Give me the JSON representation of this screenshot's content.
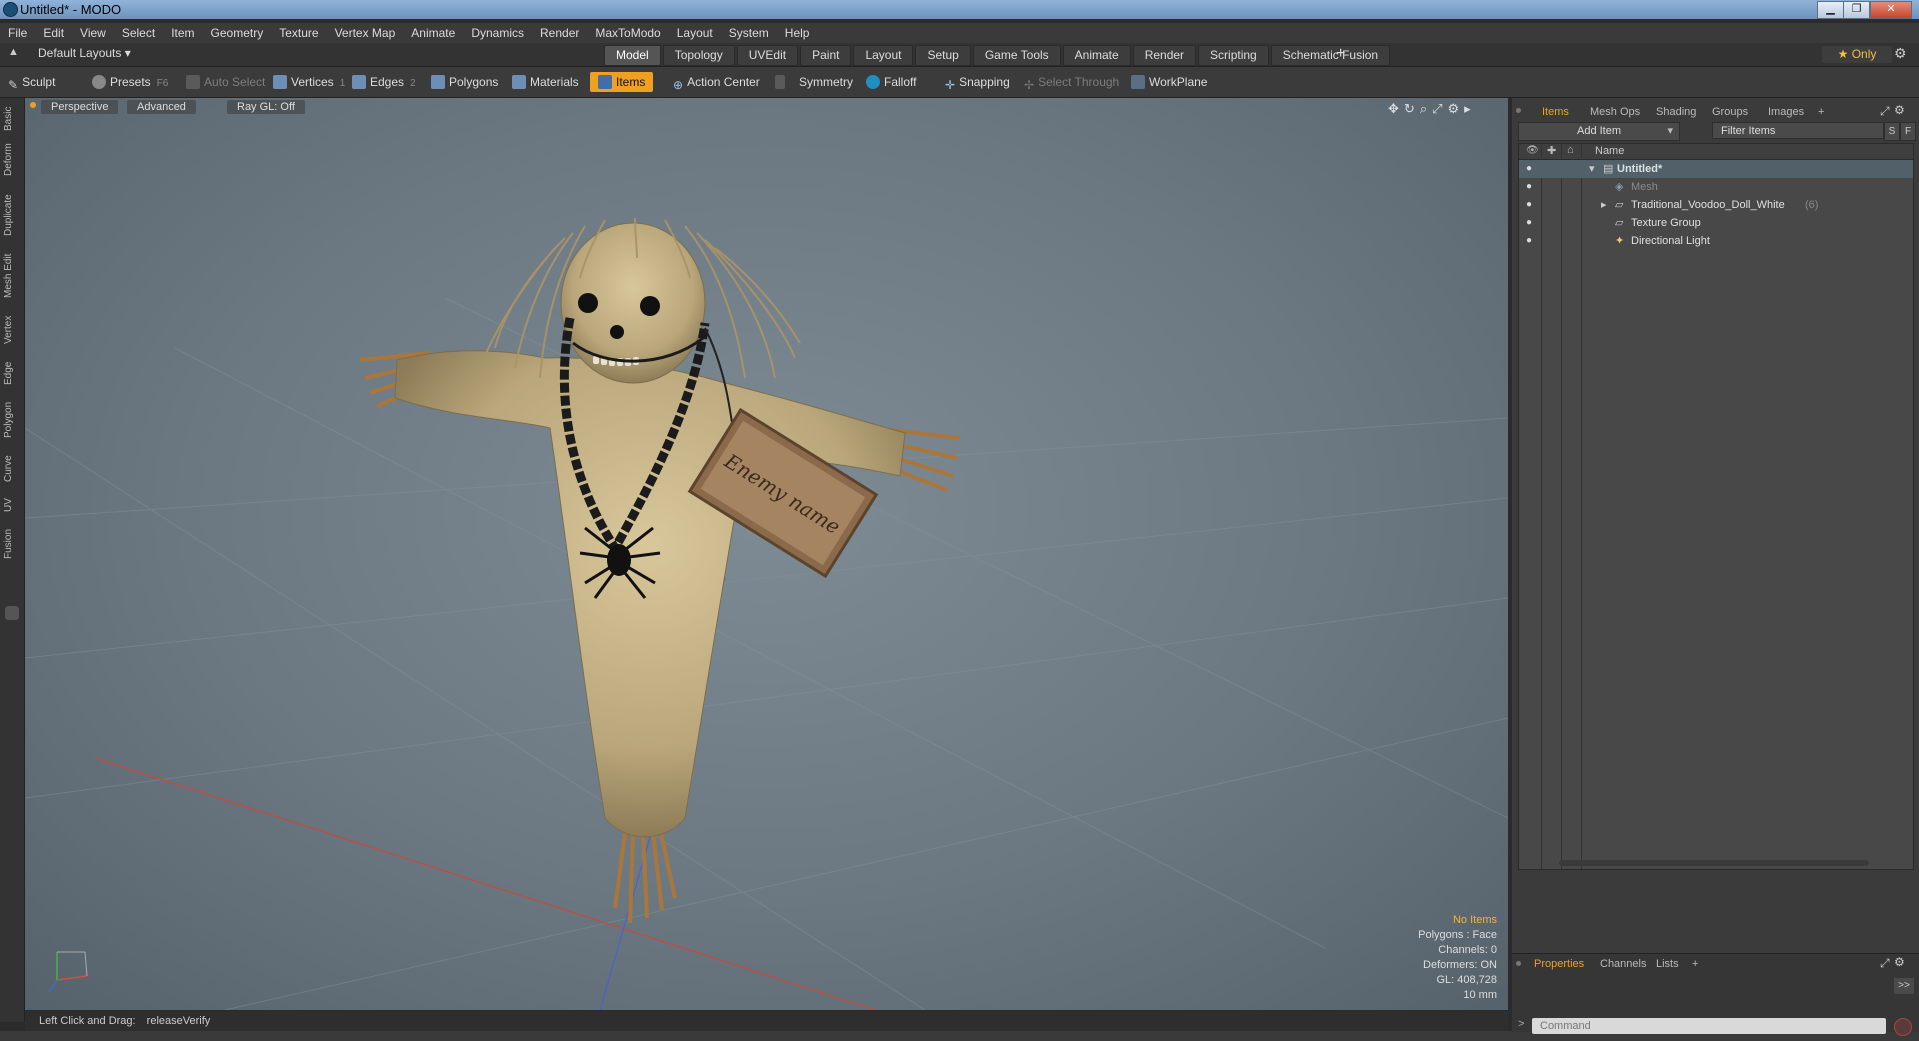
{
  "window": {
    "title": "Untitled* - MODO",
    "minimize": "▁",
    "maximize": "❐",
    "close": "✕"
  },
  "menu": [
    "File",
    "Edit",
    "View",
    "Select",
    "Item",
    "Geometry",
    "Texture",
    "Vertex Map",
    "Animate",
    "Dynamics",
    "Render",
    "MaxToModo",
    "Layout",
    "System",
    "Help"
  ],
  "layout_selector": "Default Layouts ▾",
  "layout_tabs": [
    {
      "label": "Model",
      "active": true
    },
    {
      "label": "Topology"
    },
    {
      "label": "UVEdit"
    },
    {
      "label": "Paint"
    },
    {
      "label": "Layout"
    },
    {
      "label": "Setup"
    },
    {
      "label": "Game Tools"
    },
    {
      "label": "Animate"
    },
    {
      "label": "Render"
    },
    {
      "label": "Scripting"
    },
    {
      "label": "Schematic Fusion"
    }
  ],
  "tabs_plus": "+",
  "only_label": "★ Only",
  "toolbar": {
    "sculpt": "Sculpt",
    "presets": "Presets",
    "presets_key": "F6",
    "auto_select": "Auto Select",
    "vertices": "Vertices",
    "vertices_key": "1",
    "edges": "Edges",
    "edges_key": "2",
    "polygons": "Polygons",
    "materials": "Materials",
    "items": "Items",
    "action_center": "Action Center",
    "symmetry": "Symmetry",
    "falloff": "Falloff",
    "snapping": "Snapping",
    "select_through": "Select Through",
    "workplane": "WorkPlane"
  },
  "left_tabs": [
    "Basic",
    "Deform",
    "Duplicate",
    "Mesh Edit",
    "Vertex",
    "Edge",
    "Polygon",
    "Curve",
    "UV",
    "Fusion"
  ],
  "viewport": {
    "perspective": "Perspective",
    "advanced": "Advanced",
    "raygl": "Ray GL: Off",
    "tag_text": "Enemy name",
    "hud": {
      "no_items": "No Items",
      "polygons": "Polygons : Face",
      "channels": "Channels: 0",
      "deformers": "Deformers: ON",
      "gl": "GL: 408,728",
      "unit": "10 mm"
    }
  },
  "status": {
    "hint": "Left Click and Drag:",
    "action": "releaseVerify"
  },
  "panel": {
    "tabs": [
      {
        "label": "Items",
        "active": true
      },
      {
        "label": "Mesh Ops"
      },
      {
        "label": "Shading"
      },
      {
        "label": "Groups"
      },
      {
        "label": "Images"
      },
      {
        "label": "+"
      }
    ],
    "add_item": "Add Item",
    "filter_placeholder": "Filter Items",
    "s_btn": "S",
    "f_btn": "F",
    "tree_header": "Name",
    "tree": [
      {
        "label": "Untitled*",
        "bold": true
      },
      {
        "label": "Mesh",
        "dim": true
      },
      {
        "label": "Traditional_Voodoo_Doll_White",
        "count": "(6)"
      },
      {
        "label": "Texture Group"
      },
      {
        "label": "Directional Light"
      }
    ],
    "lower_tabs": [
      {
        "label": "Properties",
        "active": true
      },
      {
        "label": "Channels"
      },
      {
        "label": "Lists"
      },
      {
        "label": "+"
      }
    ],
    "command_placeholder": "Command",
    "expand": ">>"
  },
  "colors": {
    "accent": "#f0a020",
    "viewport_bg": "#6b7882",
    "doll_cloth": "#c9b88a",
    "straw": "#b68a4a"
  }
}
